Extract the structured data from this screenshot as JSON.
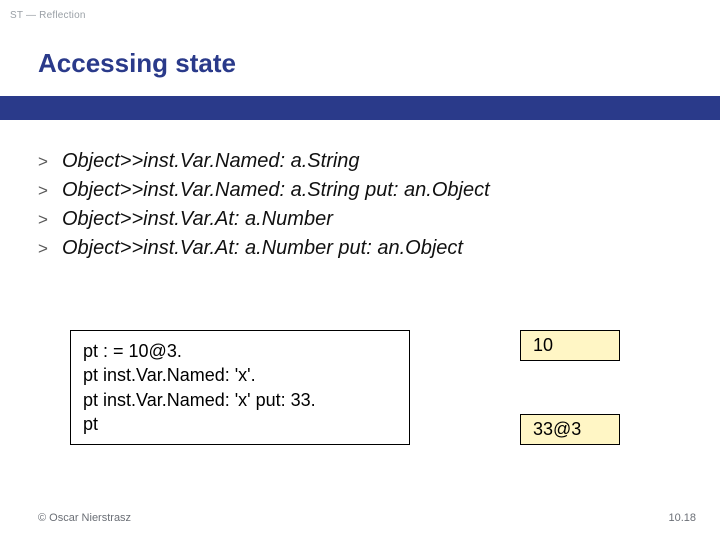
{
  "crumb": "ST — Reflection",
  "title": "Accessing state",
  "bullets": [
    "Object>>inst.Var.Named: a.String",
    "Object>>inst.Var.Named: a.String put: an.Object",
    "Object>>inst.Var.At: a.Number",
    "Object>>inst.Var.At: a.Number put: an.Object"
  ],
  "bullet_marker": ">",
  "code": {
    "l1": "pt : = 10@3.",
    "l2": "pt inst.Var.Named: 'x'.",
    "l3": "pt inst.Var.Named: 'x' put: 33.",
    "l4": "pt"
  },
  "results": {
    "r1": "10",
    "r2": "33@3"
  },
  "footer": "© Oscar Nierstrasz",
  "page": "10.18"
}
